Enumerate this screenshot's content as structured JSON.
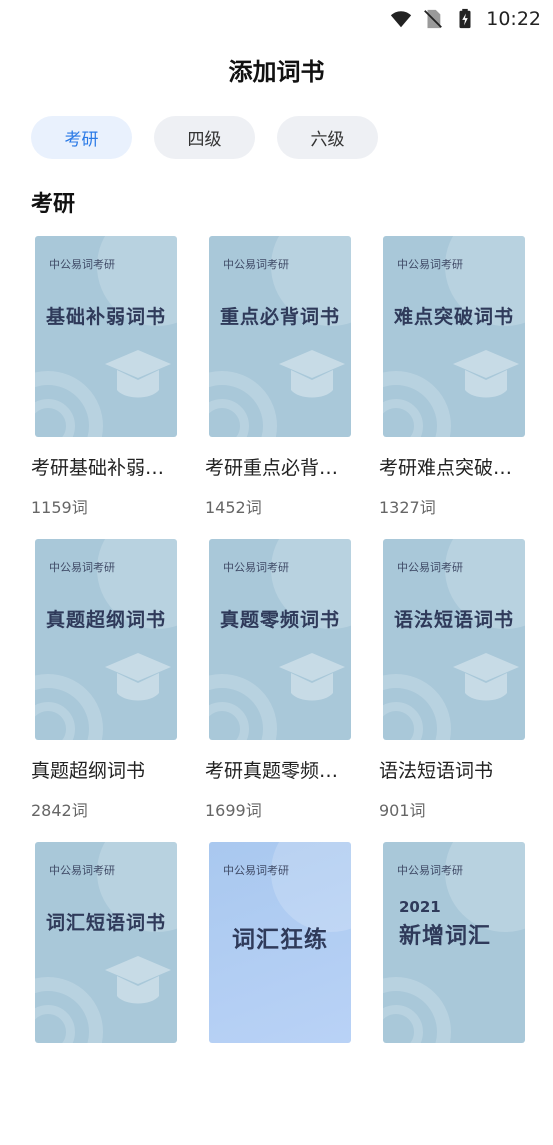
{
  "status_bar": {
    "time": "10:22",
    "icons": [
      "wifi-icon",
      "no-sim-icon",
      "battery-charging-icon"
    ]
  },
  "header": {
    "title": "添加词书"
  },
  "tabs": [
    {
      "label": "考研",
      "active": true
    },
    {
      "label": "四级",
      "active": false
    },
    {
      "label": "六级",
      "active": false
    }
  ],
  "section": {
    "title": "考研"
  },
  "colors": {
    "accent": "#2979e6",
    "cover": "#a9c8d9",
    "cover_blue": "#b0cdf3"
  },
  "books": [
    {
      "brand": "中公易词考研",
      "cover_title": "基础补弱词书",
      "name": "考研基础补弱词书",
      "count": "1159词"
    },
    {
      "brand": "中公易词考研",
      "cover_title": "重点必背词书",
      "name": "考研重点必背词书",
      "count": "1452词"
    },
    {
      "brand": "中公易词考研",
      "cover_title": "难点突破词书",
      "name": "考研难点突破词书",
      "count": "1327词"
    },
    {
      "brand": "中公易词考研",
      "cover_title": "真题超纲词书",
      "name": "真题超纲词书",
      "count": "2842词"
    },
    {
      "brand": "中公易词考研",
      "cover_title": "真题零频词书",
      "name": "考研真题零频词书",
      "count": "1699词"
    },
    {
      "brand": "中公易词考研",
      "cover_title": "语法短语词书",
      "name": "语法短语词书",
      "count": "901词"
    },
    {
      "brand": "中公易词考研",
      "cover_title": "词汇短语词书",
      "name": "",
      "count": ""
    },
    {
      "brand": "中公易词考研",
      "cover_title": "词汇狂练",
      "name": "",
      "count": ""
    },
    {
      "brand": "中公易词考研",
      "cover_year": "2021",
      "cover_title": "新增词汇",
      "name": "",
      "count": ""
    }
  ]
}
